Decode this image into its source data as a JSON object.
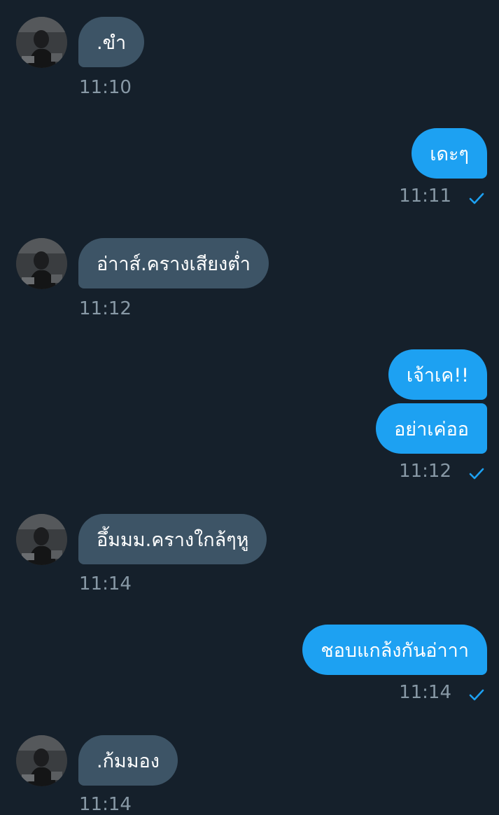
{
  "messages": [
    {
      "direction": "in",
      "text": ".ขำ",
      "time": "11:10"
    },
    {
      "direction": "out",
      "text": "เดะๆ",
      "time": "11:11",
      "status": "sent-check-icon"
    },
    {
      "direction": "in",
      "text": "อ่าาส์.ครางเสียงต่ำ",
      "time": "11:12"
    },
    {
      "direction": "out",
      "texts": [
        "เจ้าเค!!",
        "อย่าเค่ออ"
      ],
      "time": "11:12",
      "status": "sent-check-icon"
    },
    {
      "direction": "in",
      "text": "อึ้มมม.ครางใกล้ๆหู",
      "time": "11:14"
    },
    {
      "direction": "out",
      "text": "ชอบแกล้งกันอ่าาา",
      "time": "11:14",
      "status": "sent-check-icon"
    },
    {
      "direction": "in",
      "text": ".ก้มมอง",
      "time": "11:14"
    }
  ],
  "colors": {
    "background": "#15202b",
    "incoming_bubble": "#3d5466",
    "outgoing_bubble": "#1da1f2",
    "timestamp": "#8899a6",
    "check": "#1da1f2"
  }
}
